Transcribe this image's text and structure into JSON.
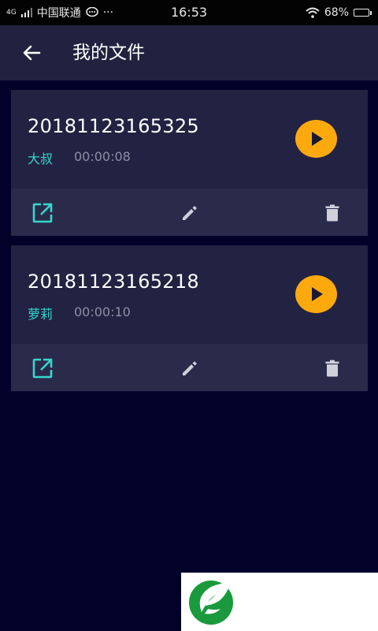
{
  "status_bar": {
    "network": "4G",
    "carrier": "中国联通",
    "more": "···",
    "time": "16:53",
    "battery_percent": "68%",
    "battery_level": 0.68
  },
  "header": {
    "title": "我的文件"
  },
  "files": [
    {
      "name": "20181123165325",
      "voice": "大叔",
      "duration": "00:00:08"
    },
    {
      "name": "20181123165218",
      "voice": "萝莉",
      "duration": "00:00:10"
    }
  ],
  "colors": {
    "background": "#01012a",
    "card": "#222242",
    "card_actions": "#2a2a4b",
    "accent_play": "#fca90d",
    "accent_teal": "#36d7cc"
  },
  "icons": {
    "back": "arrow-left-icon",
    "play": "play-icon",
    "share": "open-external-icon",
    "edit": "pencil-icon",
    "delete": "trash-icon"
  }
}
